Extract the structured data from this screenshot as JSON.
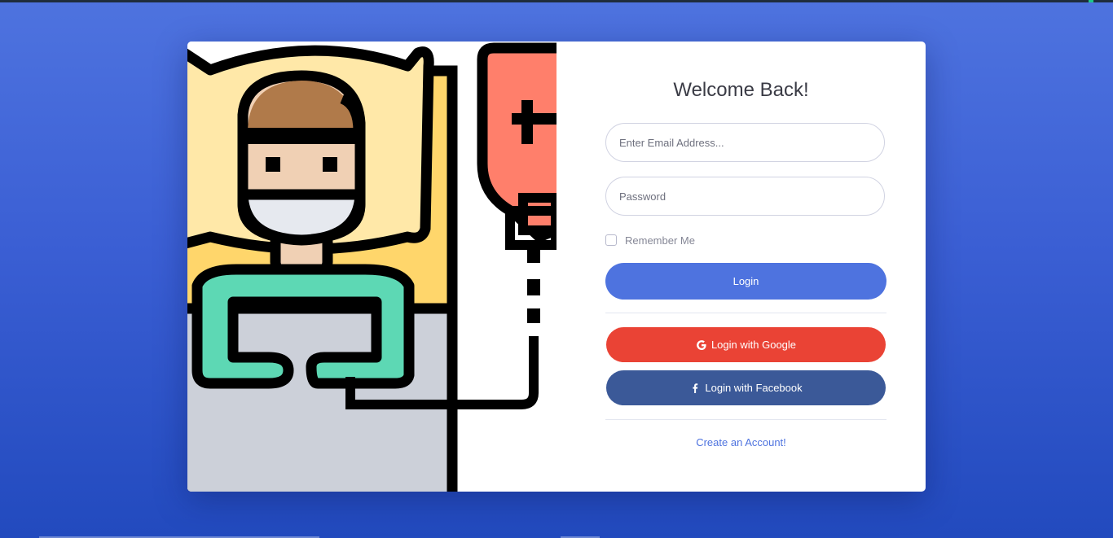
{
  "login": {
    "title": "Welcome Back!",
    "email_placeholder": "Enter Email Address...",
    "password_placeholder": "Password",
    "remember_label": "Remember Me",
    "remember_checked": false,
    "login_label": "Login",
    "google_label": "Login with Google",
    "facebook_label": "Login with Facebook",
    "create_account_label": "Create an Account!"
  },
  "illustration": {
    "subject": "patient-in-hospital-bed-with-iv-drip"
  },
  "icons": {
    "google": "google-icon",
    "facebook": "facebook-icon"
  },
  "colors": {
    "primary": "#4e73df",
    "google": "#ea4335",
    "facebook": "#3b5998",
    "background_top": "#4e73df",
    "background_bottom": "#224abe"
  }
}
